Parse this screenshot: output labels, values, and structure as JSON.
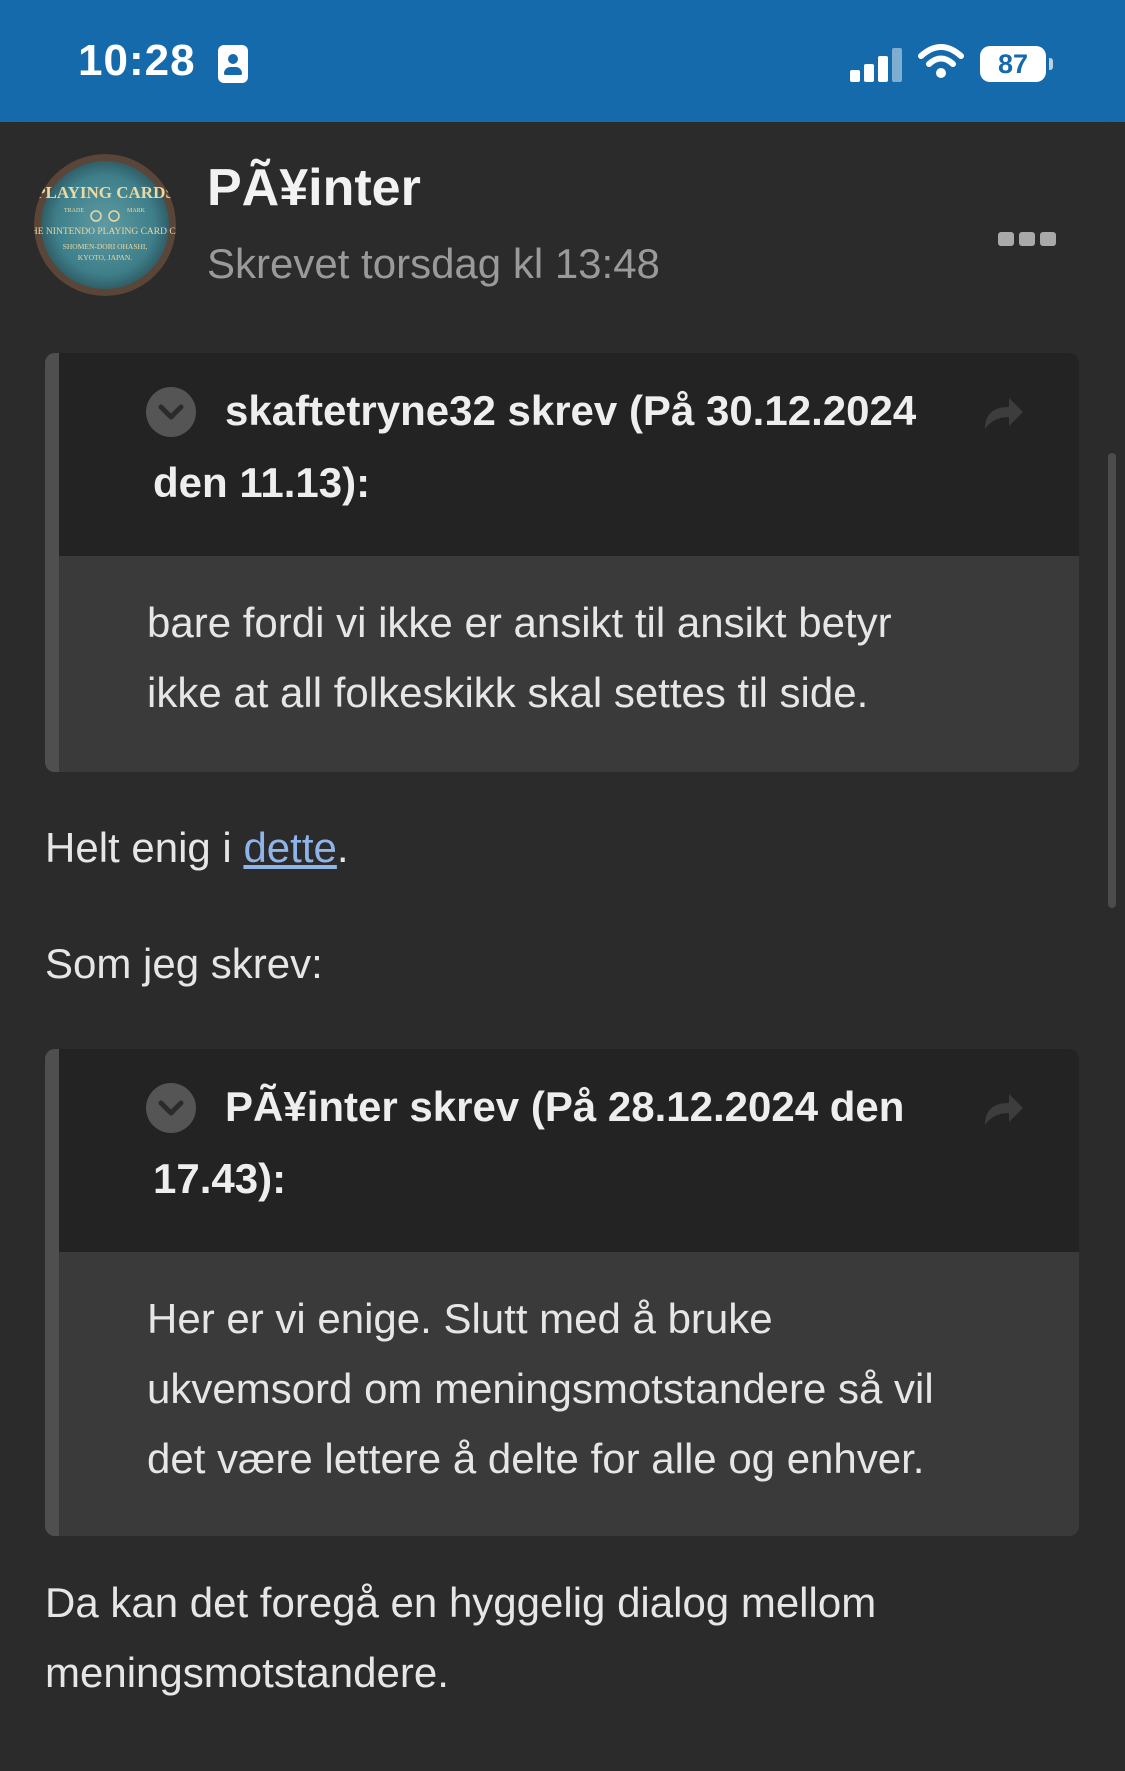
{
  "status_bar": {
    "time": "10:28",
    "battery": "87",
    "bg_color": "#146aab"
  },
  "post": {
    "author": "PÃ¥inter",
    "date": "Skrevet torsdag kl 13:48",
    "avatar_text": {
      "line1": "PLAYING CARDS",
      "line2": "THE NINTENDO PLAYING CARD CO.",
      "line3": "SHOMEN-DORI OHASHI,",
      "line4": "KYOTO, JAPAN.",
      "trade": "TRADE",
      "mark": "MARK"
    },
    "quote1": {
      "title_line1": "skaftetryne32 skrev (På 30.12.2024",
      "title_line2": "den 11.13):",
      "body_line1": "bare fordi vi ikke er ansikt til ansikt betyr",
      "body_line2": "ikke at all folkeskikk skal settes til side."
    },
    "text1_before": "Helt enig i ",
    "text1_link": "dette",
    "text1_after": ".",
    "text2": "Som jeg skrev:",
    "quote2": {
      "title_line1": "PÃ¥inter skrev (På 28.12.2024 den",
      "title_line2": "17.43):",
      "body_line1": "Her er vi enige. Slutt med å bruke",
      "body_line2": "ukvemsord om meningsmotstandere så vil",
      "body_line3": "det være lettere å delte for alle og enhver."
    },
    "text3_line1": "Da kan det foregå en hyggelig dialog mellom",
    "text3_line2": "meningsmotstandere.",
    "link_color": "#8fb4ea"
  },
  "icons": {
    "contact": "person-card-icon",
    "signal": "cellular-signal-icon",
    "wifi": "wifi-icon",
    "battery": "battery-icon",
    "more": "more-options-icon",
    "chevron": "chevron-down-icon",
    "share": "share-arrow-icon"
  }
}
